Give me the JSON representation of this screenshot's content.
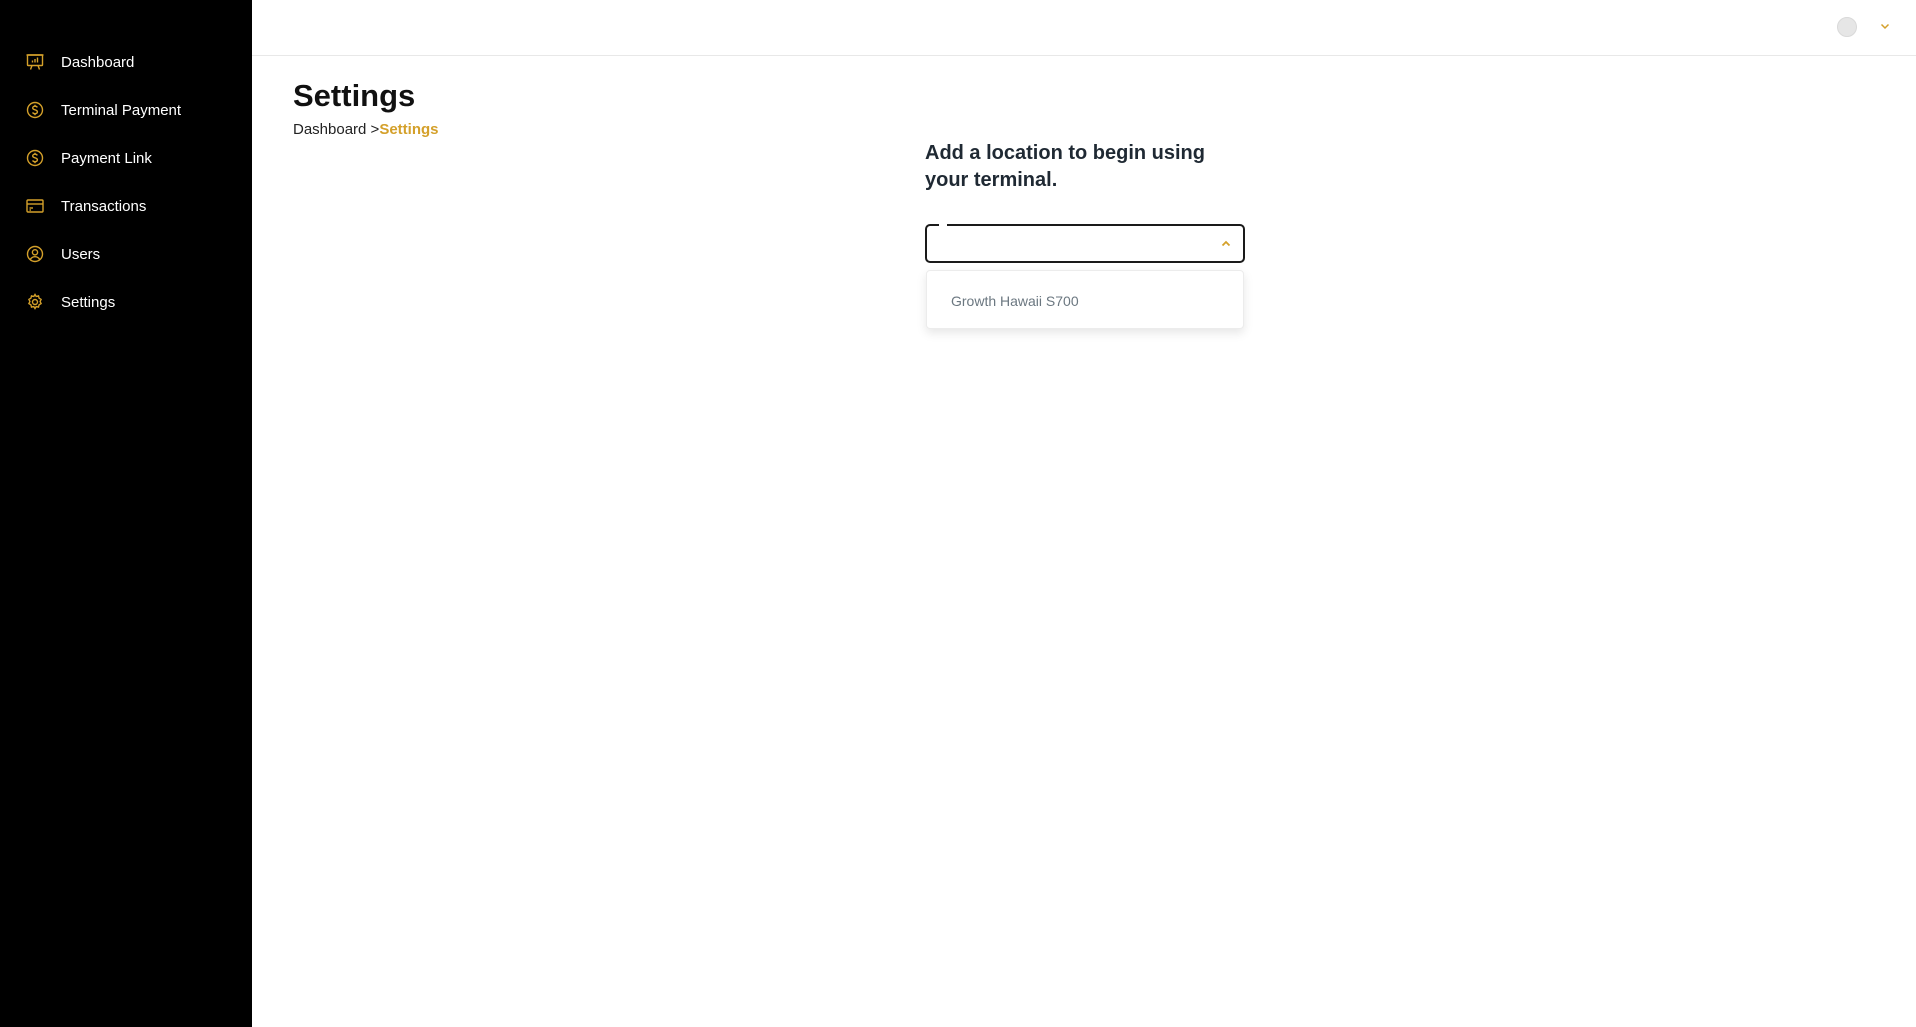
{
  "sidebar": {
    "items": [
      {
        "label": "Dashboard",
        "icon": "presentation-chart-icon"
      },
      {
        "label": "Terminal Payment",
        "icon": "dollar-circle-icon"
      },
      {
        "label": "Payment Link",
        "icon": "dollar-circle-icon"
      },
      {
        "label": "Transactions",
        "icon": "credit-card-icon"
      },
      {
        "label": "Users",
        "icon": "user-circle-icon"
      },
      {
        "label": "Settings",
        "icon": "gear-icon"
      }
    ]
  },
  "header": {
    "avatar_icon": "avatar-placeholder",
    "menu_icon": "chevron-down-icon"
  },
  "page": {
    "title": "Settings",
    "breadcrumb": {
      "root": "Dashboard >",
      "current": "Settings"
    }
  },
  "location_form": {
    "heading": "Add a location to begin using your terminal.",
    "select_value": "",
    "options": [
      "Growth Hawaii S700"
    ]
  },
  "colors": {
    "accent": "#d4a02a",
    "sidebar_bg": "#000000",
    "text_dark": "#1f2933"
  }
}
